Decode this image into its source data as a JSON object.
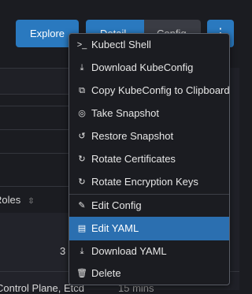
{
  "toolbar": {
    "explore_label": "Explore",
    "detail_label": "Detail",
    "config_label": "Config",
    "more_label": "⋮"
  },
  "table": {
    "roles_header": "Roles",
    "sort_icon": "⇳",
    "cell_count": "3",
    "bottom_row_roles": "Control Plane, Etcd",
    "bottom_row_age": "15 mins"
  },
  "menu": {
    "items": [
      {
        "label": "Kubectl Shell",
        "icon": ">_"
      },
      {
        "label": "Download KubeConfig",
        "icon": "⤓"
      },
      {
        "label": "Copy KubeConfig to Clipboard",
        "icon": "⧉"
      },
      {
        "label": "Take Snapshot",
        "icon": "◎"
      },
      {
        "label": "Restore Snapshot",
        "icon": "↺"
      },
      {
        "label": "Rotate Certificates",
        "icon": "↻"
      },
      {
        "label": "Rotate Encryption Keys",
        "icon": "↻"
      },
      {
        "label": "Edit Config",
        "icon": "✎"
      },
      {
        "label": "Edit YAML",
        "icon": "▤"
      },
      {
        "label": "Download YAML",
        "icon": "⤓"
      },
      {
        "label": "Delete",
        "icon": "🗑"
      }
    ],
    "active_item": "Edit YAML"
  },
  "colors": {
    "accent": "#2a79bf",
    "menu_active": "#2b6fb0",
    "background": "#1b1c21"
  }
}
